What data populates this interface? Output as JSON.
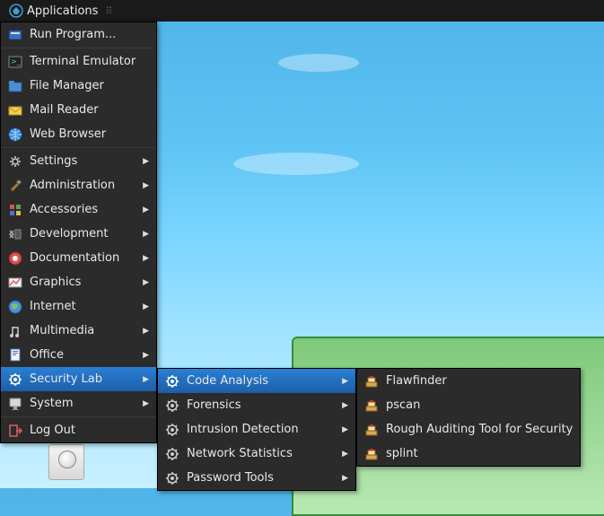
{
  "panel": {
    "app_label": "Applications"
  },
  "main_menu": {
    "run_program": "Run Program...",
    "terminal": "Terminal Emulator",
    "file_manager": "File Manager",
    "mail_reader": "Mail Reader",
    "web_browser": "Web Browser",
    "settings": "Settings",
    "administration": "Administration",
    "accessories": "Accessories",
    "development": "Development",
    "documentation": "Documentation",
    "graphics": "Graphics",
    "internet": "Internet",
    "multimedia": "Multimedia",
    "office": "Office",
    "security_lab": "Security Lab",
    "system": "System",
    "log_out": "Log Out"
  },
  "security_submenu": {
    "code_analysis": "Code Analysis",
    "forensics": "Forensics",
    "intrusion_detection": "Intrusion Detection",
    "network_statistics": "Network Statistics",
    "password_tools": "Password Tools"
  },
  "code_analysis_submenu": {
    "flawfinder": "Flawfinder",
    "pscan": "pscan",
    "rats": "Rough Auditing Tool for Security",
    "splint": "splint"
  }
}
